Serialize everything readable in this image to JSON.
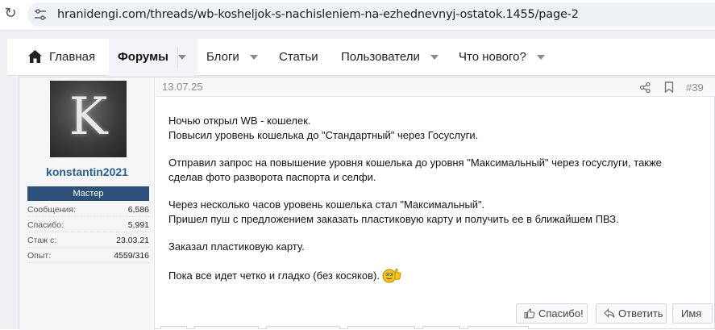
{
  "browser": {
    "url": "hranidengi.com/threads/wb-kosheljok-s-nachisleniem-na-ezhednevnyj-ostatok.1455/page-2",
    "reload_icon": "reload-icon",
    "site_info_icon": "tune-icon"
  },
  "nav": {
    "home": "Главная",
    "forums": "Форумы",
    "blogs": "Блоги",
    "articles": "Статьи",
    "users": "Пользователи",
    "whats_new": "Что нового?"
  },
  "post": {
    "date": "13.07.25",
    "number": "#39",
    "user": {
      "avatar_letter": "K",
      "name": "konstantin2021",
      "rank": "Мастер",
      "stats": [
        {
          "label": "Сообщения:",
          "value": "6,586"
        },
        {
          "label": "Спасибо:",
          "value": "5,991"
        },
        {
          "label": "Стаж с:",
          "value": "23.03.21"
        },
        {
          "label": "Опыт:",
          "value": "4559/316"
        }
      ]
    },
    "body": {
      "p1_l1": "Ночью открыл WB - кошелек.",
      "p1_l2": "Повысил уровень кошелька до \"Стандартный\" через Госуслуги.",
      "p2_l1": "Отправил запрос на повышение уровня кошелька до уровня \"Максимальный\" через госуслуги, также",
      "p2_l2": "сделав фото разворота паспорта и селфи.",
      "p3_l1": "Через несколько часов уровень кошелька стал \"Максимальный\".",
      "p3_l2": "Пришел пуш с предложением заказать пластиковую карту и получить ее в ближайшем ПВЗ.",
      "p4_l1": "Заказал пластиковую карту.",
      "p5_l1": "Пока все идет четко и гладко (без косяков)."
    },
    "actions": {
      "thanks": "Спасибо!",
      "reply": "Ответить",
      "name": "Имя"
    }
  },
  "colors": {
    "username": "#2b5e8e",
    "rank_bg": "#2d4f78"
  }
}
